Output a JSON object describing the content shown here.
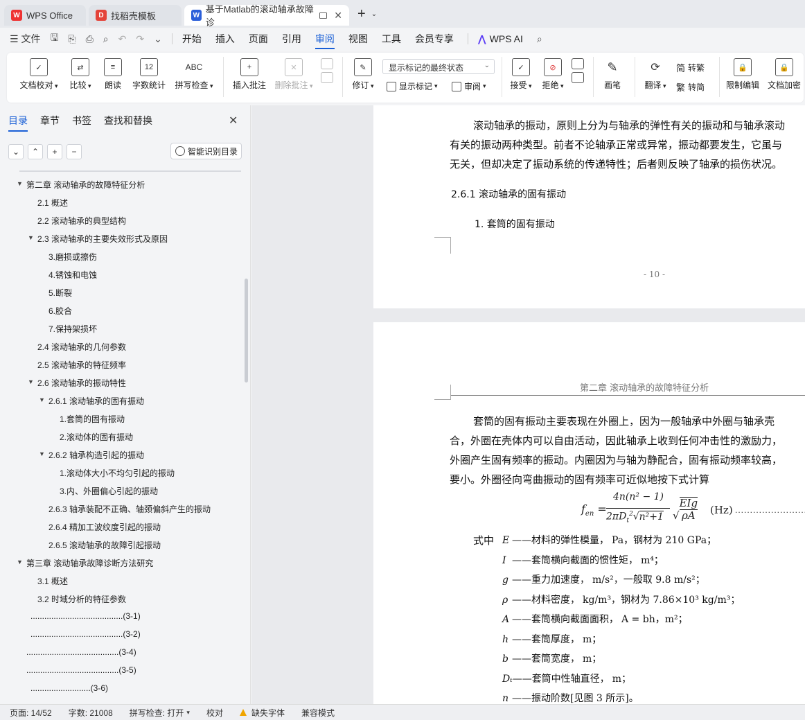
{
  "tabs": [
    {
      "label": "WPS Office",
      "icon": "wps-logo-icon"
    },
    {
      "label": "找稻壳模板",
      "icon": "docer-icon"
    },
    {
      "label": "基于Matlab的滚动轴承故障诊",
      "icon": "word-doc-icon"
    }
  ],
  "menu": {
    "file": "文件",
    "items": [
      "开始",
      "插入",
      "页面",
      "引用",
      "审阅",
      "视图",
      "工具",
      "会员专享"
    ],
    "active": "审阅",
    "wps_ai": "WPS AI"
  },
  "ribbon": {
    "doc_proof": "文档校对",
    "compare": "比较",
    "read_aloud": "朗读",
    "word_count": "字数统计",
    "spell_check": "拼写检查",
    "insert_comment": "插入批注",
    "delete_comment": "删除批注",
    "revise": "修订",
    "markup_state": "显示标记的最终状态",
    "show_markup": "显示标记",
    "review": "审阅",
    "accept": "接受",
    "reject": "拒绝",
    "ink": "画笔",
    "translate": "翻译",
    "to_traditional": "转繁",
    "to_simplified": "转简",
    "restrict_edit": "限制编辑",
    "doc_encrypt": "文档加密"
  },
  "sidebar": {
    "tabs": [
      "目录",
      "章节",
      "书签",
      "查找和替换"
    ],
    "smart_toc": "智能识别目录",
    "toc": [
      {
        "text": "第二章   滚动轴承的故障特征分析",
        "level": 0,
        "arrow": true
      },
      {
        "text": "2.1   概述",
        "level": 1
      },
      {
        "text": "2.2   滚动轴承的典型结构",
        "level": 1
      },
      {
        "text": "2.3   滚动轴承的主要失效形式及原因",
        "level": 1,
        "arrow": true
      },
      {
        "text": "3.磨损或擦伤",
        "level": 2
      },
      {
        "text": "4.锈蚀和电蚀",
        "level": 2
      },
      {
        "text": "5.断裂",
        "level": 2
      },
      {
        "text": "6.胶合",
        "level": 2
      },
      {
        "text": "7.保持架损坏",
        "level": 2
      },
      {
        "text": "2.4   滚动轴承的几何参数",
        "level": 1
      },
      {
        "text": "2.5   滚动轴承的特征频率",
        "level": 1
      },
      {
        "text": "2.6   滚动轴承的振动特性",
        "level": 1,
        "arrow": true
      },
      {
        "text": "2.6.1   滚动轴承的固有振动",
        "level": 2,
        "arrow": true
      },
      {
        "text": "1.套筒的固有振动",
        "level": 3
      },
      {
        "text": "2.滚动体的固有振动",
        "level": 3
      },
      {
        "text": "2.6.2   轴承构造引起的振动",
        "level": 2,
        "arrow": true
      },
      {
        "text": "1.滚动体大小不均匀引起的振动",
        "level": 3
      },
      {
        "text": "3.内、外圈偏心引起的振动",
        "level": 3
      },
      {
        "text": "2.6.3   轴承装配不正确、轴颈偏斜产生的振动",
        "level": 2
      },
      {
        "text": "2.6.4   精加工波纹度引起的振动",
        "level": 2
      },
      {
        "text": "2.6.5   滚动轴承的故障引起振动",
        "level": 2
      },
      {
        "text": "第三章   滚动轴承故障诊断方法研究",
        "level": 0,
        "arrow": true
      },
      {
        "text": "3.1   概述",
        "level": 1
      },
      {
        "text": "3.2   时域分析的特征参数",
        "level": 1
      },
      {
        "text": "........................................(3-1)",
        "level": 1.5
      },
      {
        "text": "........................................(3-2)",
        "level": 1.5
      },
      {
        "text": "........................................(3-4)",
        "level": 1.3
      },
      {
        "text": "........................................(3-5)",
        "level": 1.3
      },
      {
        "text": "..........................(3-6)",
        "level": 1.5
      }
    ]
  },
  "document": {
    "page1": {
      "lines": [
        "滚动轴承的振动，原则上分为与轴承的弹性有关的振动和与轴承滚动",
        "有关的振动两种类型。前者不论轴承正常或异常，振动都要发生，它虽与",
        "无关，但却决定了振动系统的传递特性；后者则反映了轴承的损伤状况。"
      ],
      "heading": "2.6.1    滚动轴承的固有振动",
      "subheading": "1.    套筒的固有振动",
      "page_number": "- 10 -"
    },
    "page2": {
      "header": "第二章    滚动轴承的故障特征分析",
      "lines": [
        "套筒的固有振动主要表现在外圈上，因为一般轴承中外圈与轴承壳",
        "合，外圈在壳体内可以自由活动，因此轴承上收到任何冲击性的激励力，",
        "外圈产生固有频率的振动。内圈因为与轴为静配合，固有振动频率较高，",
        "要小。外圈径向弯曲振动的固有频率可近似地按下式计算"
      ],
      "formula": {
        "lhs": "f",
        "lhs_sub": "en",
        "numerator": "4n(n² − 1)",
        "denominator": "2πD",
        "unit": "(Hz)"
      },
      "where_label": "式中",
      "defs": [
        {
          "sym": "E",
          "text": "——材料的弹性模量，",
          "extra": "Pa，钢材为 210 GPa；"
        },
        {
          "sym": "I",
          "text": "——套筒横向截面的惯性矩，",
          "extra": "m⁴；"
        },
        {
          "sym": "g",
          "text": "——重力加速度，",
          "extra": "m/s²，一般取 9.8 m/s²；"
        },
        {
          "sym": "ρ",
          "text": "——材料密度，",
          "extra": "kg/m³，钢材为 7.86×10³ kg/m³；"
        },
        {
          "sym": "A",
          "text": "——套筒横向截面面积，",
          "extra": "A = bh，m²；"
        },
        {
          "sym": "h",
          "text": "——套筒厚度，",
          "extra": "m；"
        },
        {
          "sym": "b",
          "text": "——套筒宽度，",
          "extra": "m；"
        },
        {
          "sym": "Dₜ",
          "text": "——套筒中性轴直径，",
          "extra": "m；"
        },
        {
          "sym": "n",
          "text": "——振动阶数[见图 3 所示]。",
          "extra": ""
        }
      ]
    }
  },
  "status": {
    "page": "页面: 14/52",
    "words": "字数: 21008",
    "spell": "拼写检查: 打开",
    "proof": "校对",
    "missing_font": "缺失字体",
    "compat": "兼容模式"
  },
  "colors": {
    "accent": "#1a5fd6",
    "warning": "#f0a500"
  }
}
